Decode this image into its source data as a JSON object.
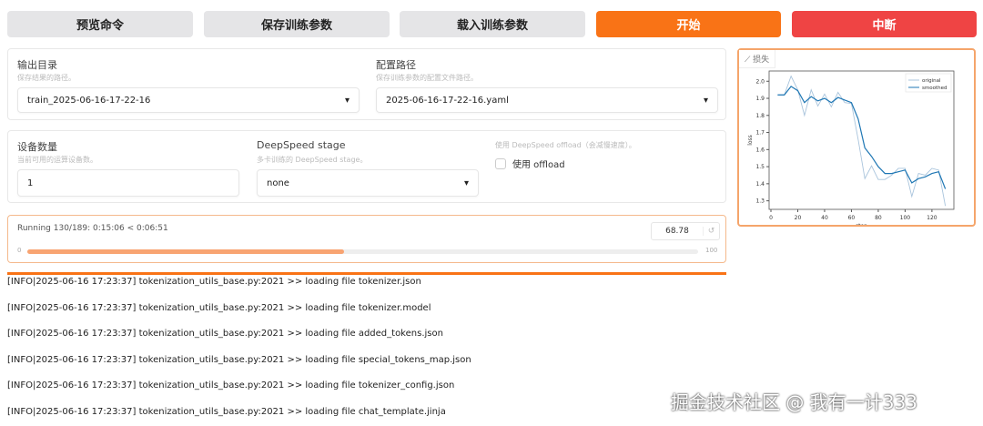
{
  "toolbar": {
    "preview": "预览命令",
    "save": "保存训练参数",
    "load": "载入训练参数",
    "start": "开始",
    "abort": "中断"
  },
  "output_dir": {
    "label": "输出目录",
    "hint": "保存结果的路径。",
    "value": "train_2025-06-16-17-22-16"
  },
  "config_path": {
    "label": "配置路径",
    "hint": "保存训练参数的配置文件路径。",
    "value": "2025-06-16-17-22-16.yaml"
  },
  "device_count": {
    "label": "设备数量",
    "hint": "当前可用的运算设备数。",
    "value": "1"
  },
  "ds_stage": {
    "label": "DeepSpeed stage",
    "hint": "多卡训练的 DeepSpeed stage。",
    "value": "none"
  },
  "offload": {
    "hint": "使用 DeepSpeed offload（会减慢速度）。",
    "label": "使用 offload",
    "checked": false
  },
  "progress": {
    "status": "Running 130/189: 0:15:06 < 0:06:51",
    "value": "68.78",
    "min": "0",
    "max": "100",
    "percent": 68.78
  },
  "logs": [
    "[INFO|2025-06-16 17:23:37] tokenization_utils_base.py:2021 >> loading file tokenizer.json",
    "[INFO|2025-06-16 17:23:37] tokenization_utils_base.py:2021 >> loading file tokenizer.model",
    "[INFO|2025-06-16 17:23:37] tokenization_utils_base.py:2021 >> loading file added_tokens.json",
    "[INFO|2025-06-16 17:23:37] tokenization_utils_base.py:2021 >> loading file special_tokens_map.json",
    "[INFO|2025-06-16 17:23:37] tokenization_utils_base.py:2021 >> loading file tokenizer_config.json",
    "[INFO|2025-06-16 17:23:37] tokenization_utils_base.py:2021 >> loading file chat_template.jinja"
  ],
  "loss_panel": {
    "label": "损失"
  },
  "watermark": "掘金技术社区 @ 我有一计333",
  "colors": {
    "accent": "#f97316",
    "abort": "#ef4444",
    "original": "#a9c4dc",
    "smoothed": "#1f77b4"
  },
  "chart_data": {
    "type": "line",
    "xlabel": "step",
    "ylabel": "loss",
    "xlim": [
      0,
      135
    ],
    "ylim": [
      1.25,
      2.06
    ],
    "xticks": [
      0,
      20,
      40,
      60,
      80,
      100,
      120
    ],
    "yticks": [
      1.3,
      1.4,
      1.5,
      1.6,
      1.7,
      1.8,
      1.9,
      2.0
    ],
    "legend": "top-right",
    "x": [
      5,
      10,
      15,
      20,
      25,
      30,
      35,
      40,
      45,
      50,
      55,
      60,
      65,
      70,
      75,
      80,
      85,
      90,
      95,
      100,
      105,
      110,
      115,
      120,
      125,
      130
    ],
    "series": [
      {
        "name": "original",
        "values": [
          1.92,
          1.92,
          2.03,
          1.95,
          1.8,
          1.95,
          1.855,
          1.925,
          1.85,
          1.935,
          1.875,
          1.87,
          1.66,
          1.43,
          1.505,
          1.425,
          1.425,
          1.45,
          1.49,
          1.49,
          1.325,
          1.46,
          1.45,
          1.49,
          1.48,
          1.27
        ]
      },
      {
        "name": "smoothed",
        "values": [
          1.92,
          1.92,
          1.97,
          1.945,
          1.875,
          1.91,
          1.885,
          1.9,
          1.875,
          1.905,
          1.89,
          1.875,
          1.78,
          1.61,
          1.56,
          1.5,
          1.46,
          1.46,
          1.47,
          1.48,
          1.405,
          1.43,
          1.44,
          1.46,
          1.47,
          1.37
        ]
      }
    ]
  }
}
